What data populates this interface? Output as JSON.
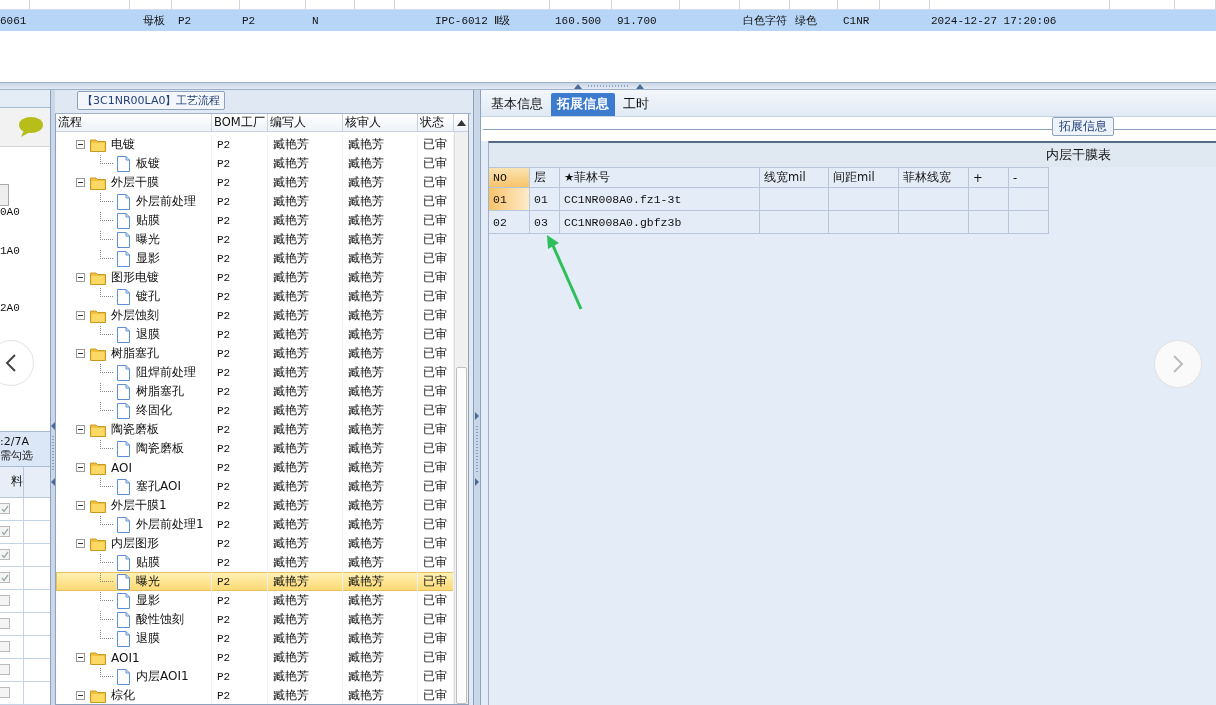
{
  "top_row": {
    "selected": true,
    "cells": [
      "6061",
      "母板",
      "P2",
      "P2",
      "N",
      "IPC-6012 Ⅱ级",
      "160.500",
      "91.700",
      "白色字符",
      "绿色",
      "C1NR",
      "2024-12-27 17:20:06"
    ]
  },
  "left_panel": {
    "codes": [
      "0A0",
      "1A0",
      "2A0"
    ],
    "info": [
      ":2/7A",
      "需勾选"
    ],
    "column": "料",
    "checks": [
      {
        "checked": true
      },
      {
        "checked": true
      },
      {
        "checked": true
      },
      {
        "checked": true
      },
      {
        "checked": false
      },
      {
        "checked": false
      },
      {
        "checked": false
      },
      {
        "checked": false
      },
      {
        "checked": false
      }
    ]
  },
  "flow": {
    "title": "【3C1NR00LA0】工艺流程",
    "columns": [
      "流程",
      "BOM工厂",
      "编写人",
      "核审人",
      "状态"
    ],
    "tree": [
      {
        "label": "电镀",
        "expanded": true,
        "selected": false,
        "bom": "P2",
        "author": "臧艳芳",
        "reviewer": "臧艳芳",
        "status": "已审",
        "children": [
          {
            "label": "板镀",
            "selected": false,
            "bom": "P2",
            "author": "臧艳芳",
            "reviewer": "臧艳芳",
            "status": "已审"
          }
        ]
      },
      {
        "label": "外层干膜",
        "expanded": true,
        "selected": false,
        "bom": "P2",
        "author": "臧艳芳",
        "reviewer": "臧艳芳",
        "status": "已审",
        "children": [
          {
            "label": "外层前处理",
            "selected": false,
            "bom": "P2",
            "author": "臧艳芳",
            "reviewer": "臧艳芳",
            "status": "已审"
          },
          {
            "label": "贴膜",
            "selected": false,
            "bom": "P2",
            "author": "臧艳芳",
            "reviewer": "臧艳芳",
            "status": "已审"
          },
          {
            "label": "曝光",
            "selected": false,
            "bom": "P2",
            "author": "臧艳芳",
            "reviewer": "臧艳芳",
            "status": "已审"
          },
          {
            "label": "显影",
            "selected": false,
            "bom": "P2",
            "author": "臧艳芳",
            "reviewer": "臧艳芳",
            "status": "已审"
          }
        ]
      },
      {
        "label": "图形电镀",
        "expanded": true,
        "selected": false,
        "bom": "P2",
        "author": "臧艳芳",
        "reviewer": "臧艳芳",
        "status": "已审",
        "children": [
          {
            "label": "镀孔",
            "selected": false,
            "bom": "P2",
            "author": "臧艳芳",
            "reviewer": "臧艳芳",
            "status": "已审"
          }
        ]
      },
      {
        "label": "外层蚀刻",
        "expanded": true,
        "selected": false,
        "bom": "P2",
        "author": "臧艳芳",
        "reviewer": "臧艳芳",
        "status": "已审",
        "children": [
          {
            "label": "退膜",
            "selected": false,
            "bom": "P2",
            "author": "臧艳芳",
            "reviewer": "臧艳芳",
            "status": "已审"
          }
        ]
      },
      {
        "label": "树脂塞孔",
        "expanded": true,
        "selected": false,
        "bom": "P2",
        "author": "臧艳芳",
        "reviewer": "臧艳芳",
        "status": "已审",
        "children": [
          {
            "label": "阻焊前处理",
            "selected": false,
            "bom": "P2",
            "author": "臧艳芳",
            "reviewer": "臧艳芳",
            "status": "已审"
          },
          {
            "label": "树脂塞孔",
            "selected": false,
            "bom": "P2",
            "author": "臧艳芳",
            "reviewer": "臧艳芳",
            "status": "已审"
          },
          {
            "label": "终固化",
            "selected": false,
            "bom": "P2",
            "author": "臧艳芳",
            "reviewer": "臧艳芳",
            "status": "已审"
          }
        ]
      },
      {
        "label": "陶瓷磨板",
        "expanded": true,
        "selected": false,
        "bom": "P2",
        "author": "臧艳芳",
        "reviewer": "臧艳芳",
        "status": "已审",
        "children": [
          {
            "label": "陶瓷磨板",
            "selected": false,
            "bom": "P2",
            "author": "臧艳芳",
            "reviewer": "臧艳芳",
            "status": "已审"
          }
        ]
      },
      {
        "label": "AOI",
        "expanded": true,
        "selected": false,
        "bom": "P2",
        "author": "臧艳芳",
        "reviewer": "臧艳芳",
        "status": "已审",
        "children": [
          {
            "label": "塞孔AOI",
            "selected": false,
            "bom": "P2",
            "author": "臧艳芳",
            "reviewer": "臧艳芳",
            "status": "已审"
          }
        ]
      },
      {
        "label": "外层干膜1",
        "expanded": true,
        "selected": false,
        "bom": "P2",
        "author": "臧艳芳",
        "reviewer": "臧艳芳",
        "status": "已审",
        "children": [
          {
            "label": "外层前处理1",
            "selected": false,
            "bom": "P2",
            "author": "臧艳芳",
            "reviewer": "臧艳芳",
            "status": "已审"
          }
        ]
      },
      {
        "label": "内层图形",
        "expanded": true,
        "selected": false,
        "bom": "P2",
        "author": "臧艳芳",
        "reviewer": "臧艳芳",
        "status": "已审",
        "children": [
          {
            "label": "贴膜",
            "selected": false,
            "bom": "P2",
            "author": "臧艳芳",
            "reviewer": "臧艳芳",
            "status": "已审"
          },
          {
            "label": "曝光",
            "selected": true,
            "bom": "P2",
            "author": "臧艳芳",
            "reviewer": "臧艳芳",
            "status": "已审"
          },
          {
            "label": "显影",
            "selected": false,
            "bom": "P2",
            "author": "臧艳芳",
            "reviewer": "臧艳芳",
            "status": "已审"
          },
          {
            "label": "酸性蚀刻",
            "selected": false,
            "bom": "P2",
            "author": "臧艳芳",
            "reviewer": "臧艳芳",
            "status": "已审"
          },
          {
            "label": "退膜",
            "selected": false,
            "bom": "P2",
            "author": "臧艳芳",
            "reviewer": "臧艳芳",
            "status": "已审"
          }
        ]
      },
      {
        "label": "AOI1",
        "expanded": true,
        "selected": false,
        "bom": "P2",
        "author": "臧艳芳",
        "reviewer": "臧艳芳",
        "status": "已审",
        "children": [
          {
            "label": "内层AOI1",
            "selected": false,
            "bom": "P2",
            "author": "臧艳芳",
            "reviewer": "臧艳芳",
            "status": "已审"
          }
        ]
      },
      {
        "label": "棕化",
        "expanded": true,
        "selected": false,
        "bom": "P2",
        "author": "臧艳芳",
        "reviewer": "臧艳芳",
        "status": "已审"
      }
    ]
  },
  "detail": {
    "tabs": [
      {
        "label": "基本信息",
        "selected": false
      },
      {
        "label": "拓展信息",
        "selected": true
      },
      {
        "label": "工时",
        "selected": false
      }
    ],
    "group_title": "拓展信息",
    "table_title": "内层干膜表",
    "columns": [
      "NO",
      "层",
      "★菲林号",
      "线宽mil",
      "间距mil",
      "菲林线宽",
      "+",
      "-"
    ],
    "rows": [
      {
        "selected": true,
        "cells": [
          "01",
          "01",
          "CC1NR008A0.fz1-3t"
        ]
      },
      {
        "selected": false,
        "cells": [
          "02",
          "03",
          "CC1NR008A0.gbfz3b"
        ]
      }
    ]
  }
}
